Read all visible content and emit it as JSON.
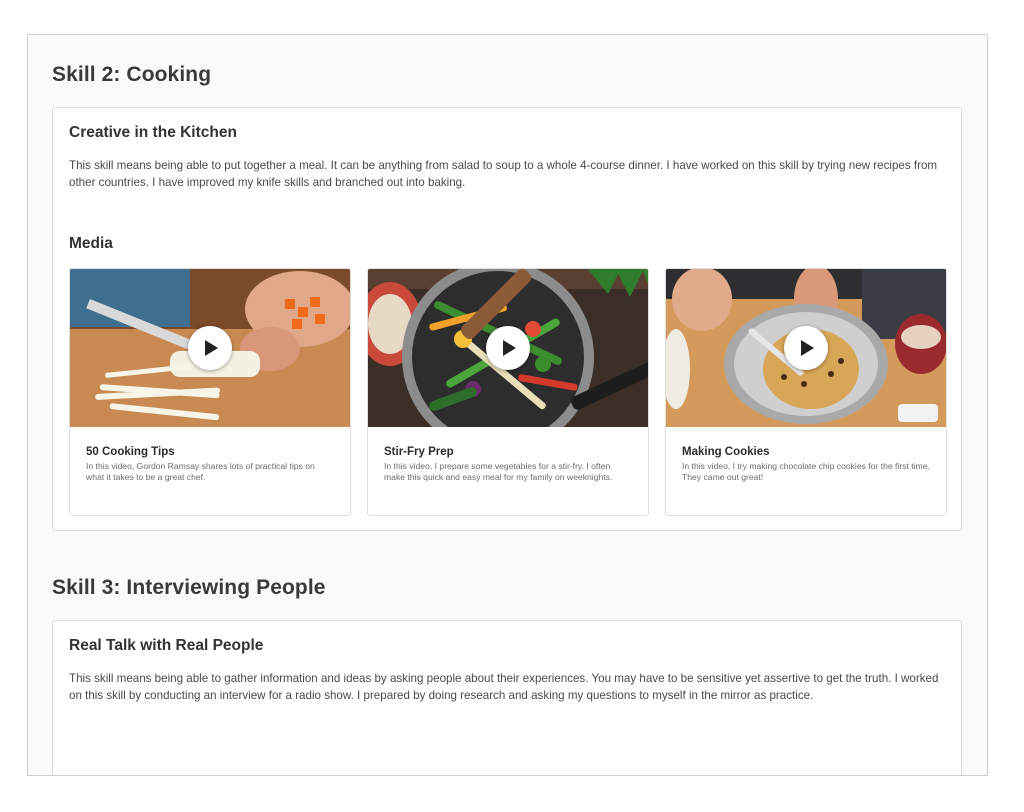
{
  "skills": [
    {
      "heading": "Skill 2: Cooking",
      "card_title": "Creative in the Kitchen",
      "description": "This skill means being able to put together a meal. It can be anything from salad to soup to a whole 4-course dinner. I have worked on this skill by trying new recipes from other countries. I have improved my knife skills and branched out into baking.",
      "media_label": "Media",
      "media": [
        {
          "title": "50 Cooking Tips",
          "description": "In this video, Gordon Ramsay shares lots of practical tips on what it takes to be a great chef.",
          "icon": "play-icon"
        },
        {
          "title": "Stir-Fry Prep",
          "description": "In this video, I prepare some vegetables for a stir-fry. I often make this quick and easy meal for my family on weeknights.",
          "icon": "play-icon"
        },
        {
          "title": "Making Cookies",
          "description": "In this video, I try making chocolate chip cookies for the first time. They came out great!",
          "icon": "play-icon"
        }
      ]
    },
    {
      "heading": "Skill 3: Interviewing People",
      "card_title": "Real Talk with Real People",
      "description": "This skill means being able to gather information and ideas by asking people about their experiences. You may have to be sensitive yet assertive to get the truth. I worked on this skill by conducting an interview for a radio show. I prepared by doing research and asking my questions to myself in the mirror as practice."
    }
  ],
  "colors": {
    "frame_border": "#cfcfcf",
    "panel_border": "#dcdcdc",
    "heading_text": "#3a3a3a",
    "body_text": "#4a4a4a"
  }
}
